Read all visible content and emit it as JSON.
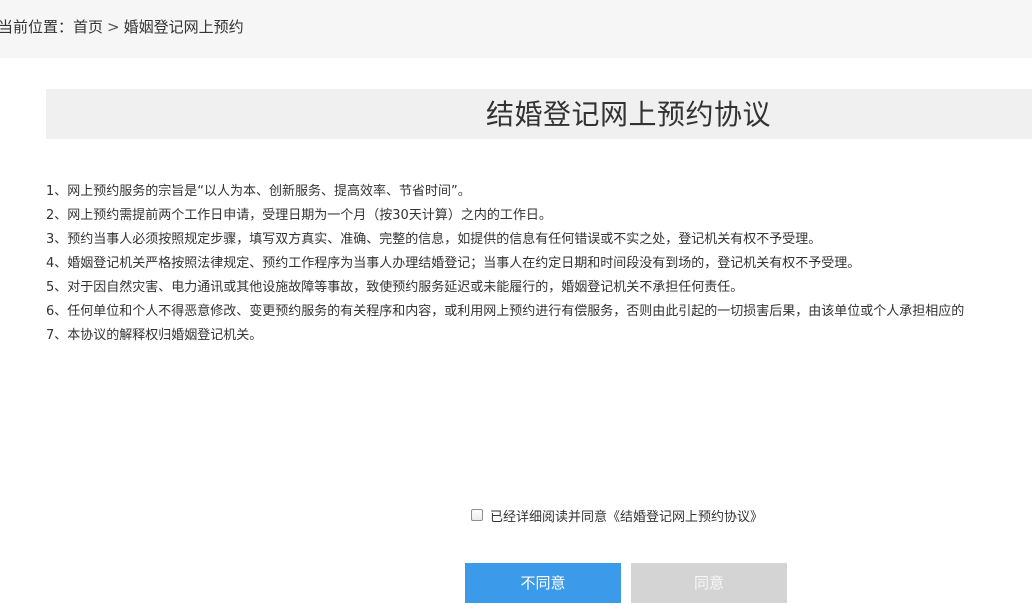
{
  "breadcrumb": {
    "prefix": "当前位置：",
    "home": "首页",
    "separator": ">",
    "current": "婚姻登记网上预约"
  },
  "page": {
    "title": "结婚登记网上预约协议"
  },
  "terms": [
    "1、网上预约服务的宗旨是“以人为本、创新服务、提高效率、节省时间”。",
    "2、网上预约需提前两个工作日申请，受理日期为一个月（按30天计算）之内的工作日。",
    "3、预约当事人必须按照规定步骤，填写双方真实、准确、完整的信息，如提供的信息有任何错误或不实之处，登记机关有权不予受理。",
    "4、婚姻登记机关严格按照法律规定、预约工作程序为当事人办理结婚登记；当事人在约定日期和时间段没有到场的，登记机关有权不予受理。",
    "5、对于因自然灾害、电力通讯或其他设施故障等事故，致使预约服务延迟或未能履行的，婚姻登记机关不承担任何责任。",
    "6、任何单位和个人不得恶意修改、变更预约服务的有关程序和内容，或利用网上预约进行有偿服务，否则由此引起的一切损害后果，由该单位或个人承担相应的",
    "7、本协议的解释权归婚姻登记机关。"
  ],
  "agreement": {
    "checkbox_label": "已经详细阅读并同意《结婚登记网上预约协议》",
    "checked": false
  },
  "buttons": {
    "disagree_label": "不同意",
    "agree_label": "同意",
    "disagree_color": "#3b9bea",
    "agree_color": "#d4d4d4"
  }
}
